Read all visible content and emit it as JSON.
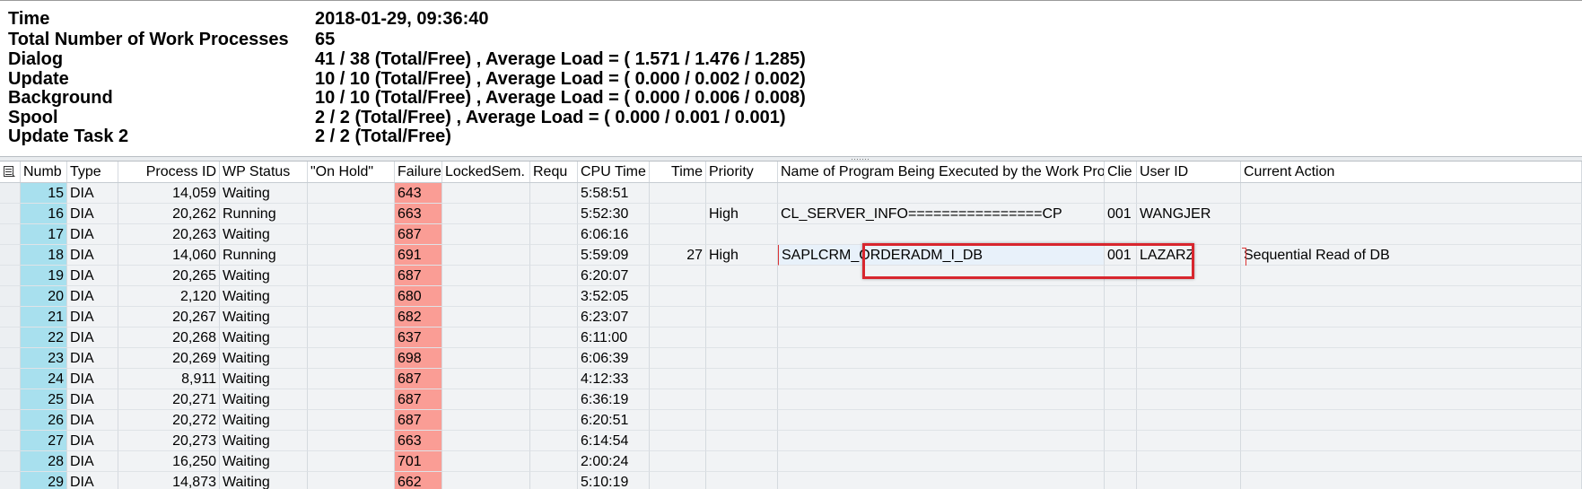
{
  "info": {
    "rows": [
      {
        "label": "Time",
        "value": "2018-01-29, 09:36:40"
      },
      {
        "label": "Total Number of Work Processes",
        "value": "65"
      },
      {
        "label": "Dialog",
        "value": "41 / 38 (Total/Free) , Average Load = ( 1.571 / 1.476 / 1.285)"
      },
      {
        "label": "Update",
        "value": "10 / 10 (Total/Free) , Average Load = ( 0.000 / 0.002 / 0.002)"
      },
      {
        "label": "Background",
        "value": "10 / 10 (Total/Free) , Average Load = ( 0.000 / 0.006 / 0.008)"
      },
      {
        "label": "Spool",
        "value": "2 / 2 (Total/Free) , Average Load = ( 0.000 / 0.001 / 0.001)"
      },
      {
        "label": "Update Task 2",
        "value": "2 / 2 (Total/Free)"
      }
    ]
  },
  "grid": {
    "headers": {
      "numb": "Numb",
      "type": "Type",
      "pid": "Process ID",
      "status": "WP Status",
      "hold": "\"On Hold\"",
      "failures": "Failures",
      "locked": "LockedSem.",
      "requ": "Requ",
      "cpu": "CPU Time",
      "time": "Time",
      "priority": "Priority",
      "program": "Name of Program Being Executed by the Work Process",
      "client": "Clie",
      "user": "User ID",
      "action": "Current Action"
    },
    "rows": [
      {
        "numb": "15",
        "type": "DIA",
        "pid": "14,059",
        "status": "Waiting",
        "hold": "",
        "failures": "643",
        "locked": "",
        "requ": "",
        "cpu": "5:58:51",
        "time": "",
        "priority": "",
        "program": "",
        "client": "",
        "user": "",
        "action": ""
      },
      {
        "numb": "16",
        "type": "DIA",
        "pid": "20,262",
        "status": "Running",
        "hold": "",
        "failures": "663",
        "locked": "",
        "requ": "",
        "cpu": "5:52:30",
        "time": "",
        "priority": "High",
        "program": "CL_SERVER_INFO================CP",
        "client": "001",
        "user": "WANGJER",
        "action": ""
      },
      {
        "numb": "17",
        "type": "DIA",
        "pid": "20,263",
        "status": "Waiting",
        "hold": "",
        "failures": "687",
        "locked": "",
        "requ": "",
        "cpu": "6:06:16",
        "time": "",
        "priority": "",
        "program": "",
        "client": "",
        "user": "",
        "action": ""
      },
      {
        "numb": "18",
        "type": "DIA",
        "pid": "14,060",
        "status": "Running",
        "hold": "",
        "failures": "691",
        "locked": "",
        "requ": "",
        "cpu": "5:59:09",
        "time": "27",
        "priority": "High",
        "program": "SAPLCRM_ORDERADM_I_DB",
        "client": "001",
        "user": "LAZARZ",
        "action": "Sequential Read of DB"
      },
      {
        "numb": "19",
        "type": "DIA",
        "pid": "20,265",
        "status": "Waiting",
        "hold": "",
        "failures": "687",
        "locked": "",
        "requ": "",
        "cpu": "6:20:07",
        "time": "",
        "priority": "",
        "program": "",
        "client": "",
        "user": "",
        "action": ""
      },
      {
        "numb": "20",
        "type": "DIA",
        "pid": "2,120",
        "status": "Waiting",
        "hold": "",
        "failures": "680",
        "locked": "",
        "requ": "",
        "cpu": "3:52:05",
        "time": "",
        "priority": "",
        "program": "",
        "client": "",
        "user": "",
        "action": ""
      },
      {
        "numb": "21",
        "type": "DIA",
        "pid": "20,267",
        "status": "Waiting",
        "hold": "",
        "failures": "682",
        "locked": "",
        "requ": "",
        "cpu": "6:23:07",
        "time": "",
        "priority": "",
        "program": "",
        "client": "",
        "user": "",
        "action": ""
      },
      {
        "numb": "22",
        "type": "DIA",
        "pid": "20,268",
        "status": "Waiting",
        "hold": "",
        "failures": "637",
        "locked": "",
        "requ": "",
        "cpu": "6:11:00",
        "time": "",
        "priority": "",
        "program": "",
        "client": "",
        "user": "",
        "action": ""
      },
      {
        "numb": "23",
        "type": "DIA",
        "pid": "20,269",
        "status": "Waiting",
        "hold": "",
        "failures": "698",
        "locked": "",
        "requ": "",
        "cpu": "6:06:39",
        "time": "",
        "priority": "",
        "program": "",
        "client": "",
        "user": "",
        "action": ""
      },
      {
        "numb": "24",
        "type": "DIA",
        "pid": "8,911",
        "status": "Waiting",
        "hold": "",
        "failures": "687",
        "locked": "",
        "requ": "",
        "cpu": "4:12:33",
        "time": "",
        "priority": "",
        "program": "",
        "client": "",
        "user": "",
        "action": ""
      },
      {
        "numb": "25",
        "type": "DIA",
        "pid": "20,271",
        "status": "Waiting",
        "hold": "",
        "failures": "687",
        "locked": "",
        "requ": "",
        "cpu": "6:36:19",
        "time": "",
        "priority": "",
        "program": "",
        "client": "",
        "user": "",
        "action": ""
      },
      {
        "numb": "26",
        "type": "DIA",
        "pid": "20,272",
        "status": "Waiting",
        "hold": "",
        "failures": "687",
        "locked": "",
        "requ": "",
        "cpu": "6:20:51",
        "time": "",
        "priority": "",
        "program": "",
        "client": "",
        "user": "",
        "action": ""
      },
      {
        "numb": "27",
        "type": "DIA",
        "pid": "20,273",
        "status": "Waiting",
        "hold": "",
        "failures": "663",
        "locked": "",
        "requ": "",
        "cpu": "6:14:54",
        "time": "",
        "priority": "",
        "program": "",
        "client": "",
        "user": "",
        "action": ""
      },
      {
        "numb": "28",
        "type": "DIA",
        "pid": "16,250",
        "status": "Waiting",
        "hold": "",
        "failures": "701",
        "locked": "",
        "requ": "",
        "cpu": "2:00:24",
        "time": "",
        "priority": "",
        "program": "",
        "client": "",
        "user": "",
        "action": ""
      },
      {
        "numb": "29",
        "type": "DIA",
        "pid": "14,873",
        "status": "Waiting",
        "hold": "",
        "failures": "662",
        "locked": "",
        "requ": "",
        "cpu": "5:10:19",
        "time": "",
        "priority": "",
        "program": "",
        "client": "",
        "user": "",
        "action": ""
      }
    ]
  },
  "colors": {
    "key_column": "#a8e0ee",
    "failure_cell": "#fa9d95",
    "highlight_border": "#d8262e"
  }
}
